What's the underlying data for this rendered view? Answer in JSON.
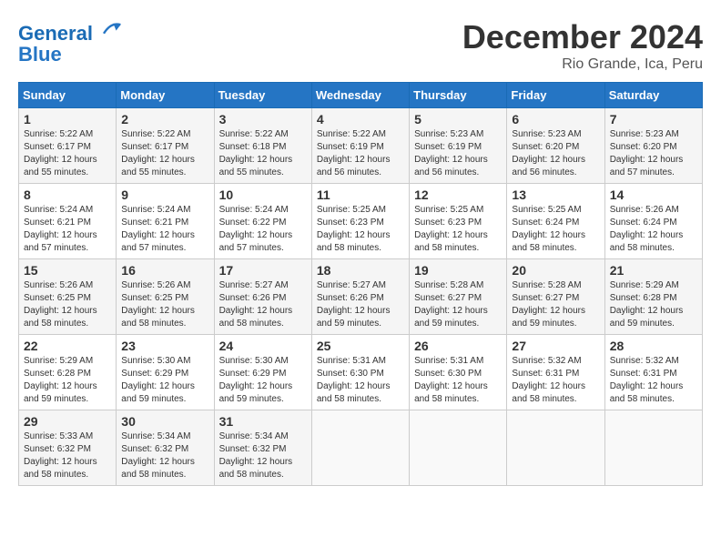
{
  "header": {
    "logo_line1": "General",
    "logo_line2": "Blue",
    "month": "December 2024",
    "location": "Rio Grande, Ica, Peru"
  },
  "days_of_week": [
    "Sunday",
    "Monday",
    "Tuesday",
    "Wednesday",
    "Thursday",
    "Friday",
    "Saturday"
  ],
  "weeks": [
    [
      {
        "day": "1",
        "sunrise": "5:22 AM",
        "sunset": "6:17 PM",
        "daylight": "12 hours and 55 minutes."
      },
      {
        "day": "2",
        "sunrise": "5:22 AM",
        "sunset": "6:17 PM",
        "daylight": "12 hours and 55 minutes."
      },
      {
        "day": "3",
        "sunrise": "5:22 AM",
        "sunset": "6:18 PM",
        "daylight": "12 hours and 55 minutes."
      },
      {
        "day": "4",
        "sunrise": "5:22 AM",
        "sunset": "6:19 PM",
        "daylight": "12 hours and 56 minutes."
      },
      {
        "day": "5",
        "sunrise": "5:23 AM",
        "sunset": "6:19 PM",
        "daylight": "12 hours and 56 minutes."
      },
      {
        "day": "6",
        "sunrise": "5:23 AM",
        "sunset": "6:20 PM",
        "daylight": "12 hours and 56 minutes."
      },
      {
        "day": "7",
        "sunrise": "5:23 AM",
        "sunset": "6:20 PM",
        "daylight": "12 hours and 57 minutes."
      }
    ],
    [
      {
        "day": "8",
        "sunrise": "5:24 AM",
        "sunset": "6:21 PM",
        "daylight": "12 hours and 57 minutes."
      },
      {
        "day": "9",
        "sunrise": "5:24 AM",
        "sunset": "6:21 PM",
        "daylight": "12 hours and 57 minutes."
      },
      {
        "day": "10",
        "sunrise": "5:24 AM",
        "sunset": "6:22 PM",
        "daylight": "12 hours and 57 minutes."
      },
      {
        "day": "11",
        "sunrise": "5:25 AM",
        "sunset": "6:23 PM",
        "daylight": "12 hours and 58 minutes."
      },
      {
        "day": "12",
        "sunrise": "5:25 AM",
        "sunset": "6:23 PM",
        "daylight": "12 hours and 58 minutes."
      },
      {
        "day": "13",
        "sunrise": "5:25 AM",
        "sunset": "6:24 PM",
        "daylight": "12 hours and 58 minutes."
      },
      {
        "day": "14",
        "sunrise": "5:26 AM",
        "sunset": "6:24 PM",
        "daylight": "12 hours and 58 minutes."
      }
    ],
    [
      {
        "day": "15",
        "sunrise": "5:26 AM",
        "sunset": "6:25 PM",
        "daylight": "12 hours and 58 minutes."
      },
      {
        "day": "16",
        "sunrise": "5:26 AM",
        "sunset": "6:25 PM",
        "daylight": "12 hours and 58 minutes."
      },
      {
        "day": "17",
        "sunrise": "5:27 AM",
        "sunset": "6:26 PM",
        "daylight": "12 hours and 58 minutes."
      },
      {
        "day": "18",
        "sunrise": "5:27 AM",
        "sunset": "6:26 PM",
        "daylight": "12 hours and 59 minutes."
      },
      {
        "day": "19",
        "sunrise": "5:28 AM",
        "sunset": "6:27 PM",
        "daylight": "12 hours and 59 minutes."
      },
      {
        "day": "20",
        "sunrise": "5:28 AM",
        "sunset": "6:27 PM",
        "daylight": "12 hours and 59 minutes."
      },
      {
        "day": "21",
        "sunrise": "5:29 AM",
        "sunset": "6:28 PM",
        "daylight": "12 hours and 59 minutes."
      }
    ],
    [
      {
        "day": "22",
        "sunrise": "5:29 AM",
        "sunset": "6:28 PM",
        "daylight": "12 hours and 59 minutes."
      },
      {
        "day": "23",
        "sunrise": "5:30 AM",
        "sunset": "6:29 PM",
        "daylight": "12 hours and 59 minutes."
      },
      {
        "day": "24",
        "sunrise": "5:30 AM",
        "sunset": "6:29 PM",
        "daylight": "12 hours and 59 minutes."
      },
      {
        "day": "25",
        "sunrise": "5:31 AM",
        "sunset": "6:30 PM",
        "daylight": "12 hours and 58 minutes."
      },
      {
        "day": "26",
        "sunrise": "5:31 AM",
        "sunset": "6:30 PM",
        "daylight": "12 hours and 58 minutes."
      },
      {
        "day": "27",
        "sunrise": "5:32 AM",
        "sunset": "6:31 PM",
        "daylight": "12 hours and 58 minutes."
      },
      {
        "day": "28",
        "sunrise": "5:32 AM",
        "sunset": "6:31 PM",
        "daylight": "12 hours and 58 minutes."
      }
    ],
    [
      {
        "day": "29",
        "sunrise": "5:33 AM",
        "sunset": "6:32 PM",
        "daylight": "12 hours and 58 minutes."
      },
      {
        "day": "30",
        "sunrise": "5:34 AM",
        "sunset": "6:32 PM",
        "daylight": "12 hours and 58 minutes."
      },
      {
        "day": "31",
        "sunrise": "5:34 AM",
        "sunset": "6:32 PM",
        "daylight": "12 hours and 58 minutes."
      },
      null,
      null,
      null,
      null
    ]
  ]
}
